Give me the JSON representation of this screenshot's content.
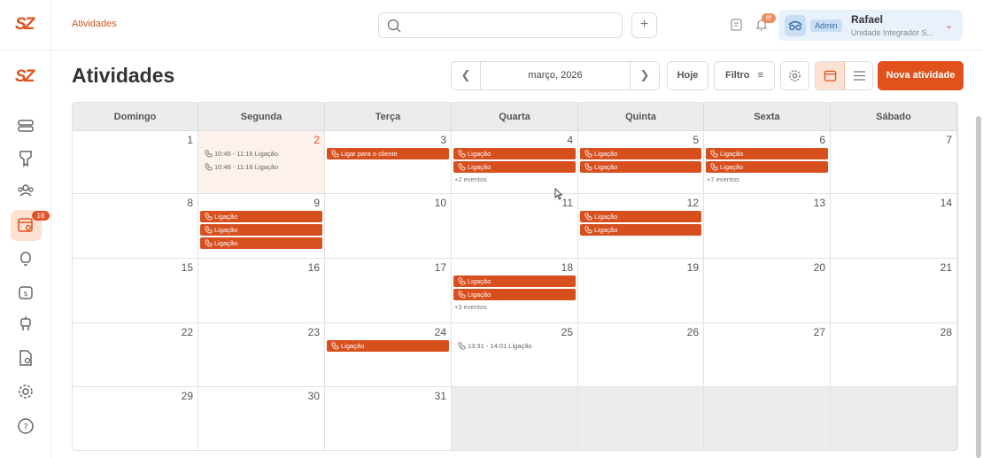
{
  "header": {
    "logo": "SZ",
    "breadcrumb": "Atividades",
    "search_placeholder": "",
    "plus_label": "+",
    "notification_count": "@",
    "user": {
      "role": "Admin",
      "name": "Rafael",
      "unit": "Unidade Integrador S..."
    }
  },
  "sidebar": {
    "logo": "SZ",
    "items": [
      {
        "icon": "layers-icon"
      },
      {
        "icon": "pin-icon"
      },
      {
        "icon": "users-icon"
      },
      {
        "icon": "calendar-search-icon",
        "badge": "16",
        "active": true
      },
      {
        "icon": "lightbulb-icon"
      },
      {
        "icon": "money-bag-icon"
      },
      {
        "icon": "robot-icon"
      },
      {
        "icon": "document-settings-icon"
      },
      {
        "icon": "gear-icon"
      },
      {
        "icon": "help-icon"
      }
    ]
  },
  "page": {
    "title": "Atividades",
    "month": "março, 2026",
    "today_label": "Hoje",
    "filter_label": "Filtro",
    "new_label": "Nova atividade"
  },
  "calendar": {
    "weekdays": [
      "Domingo",
      "Segunda",
      "Terça",
      "Quarta",
      "Quinta",
      "Sexta",
      "Sábado"
    ],
    "weeks": [
      [
        {
          "d": "1",
          "ev": []
        },
        {
          "d": "2",
          "today": true,
          "ev": [
            {
              "t": "10:46 - 11:16 Ligação",
              "plain": true
            },
            {
              "t": "10:46 - 11:16 Ligação",
              "plain": true
            }
          ]
        },
        {
          "d": "3",
          "ev": [
            {
              "t": "Ligar para o cliente"
            }
          ]
        },
        {
          "d": "4",
          "ev": [
            {
              "t": "Ligação"
            },
            {
              "t": "Ligação"
            }
          ],
          "more": "+2 eventos"
        },
        {
          "d": "5",
          "ev": [
            {
              "t": "Ligação"
            },
            {
              "t": "Ligação"
            }
          ]
        },
        {
          "d": "6",
          "ev": [
            {
              "t": "Ligação"
            },
            {
              "t": "Ligação"
            }
          ],
          "more": "+7 eventos"
        },
        {
          "d": "7",
          "ev": []
        }
      ],
      [
        {
          "d": "8",
          "ev": []
        },
        {
          "d": "9",
          "ev": [
            {
              "t": "Ligação"
            },
            {
              "t": "Ligação"
            },
            {
              "t": "Ligação"
            }
          ]
        },
        {
          "d": "10",
          "ev": []
        },
        {
          "d": "11",
          "ev": []
        },
        {
          "d": "12",
          "ev": [
            {
              "t": "Ligação"
            },
            {
              "t": "Ligação"
            }
          ]
        },
        {
          "d": "13",
          "ev": []
        },
        {
          "d": "14",
          "ev": []
        }
      ],
      [
        {
          "d": "15",
          "ev": []
        },
        {
          "d": "16",
          "ev": []
        },
        {
          "d": "17",
          "ev": []
        },
        {
          "d": "18",
          "ev": [
            {
              "t": "Ligação"
            },
            {
              "t": "Ligação"
            }
          ],
          "more": "+3 eventos"
        },
        {
          "d": "19",
          "ev": []
        },
        {
          "d": "20",
          "ev": []
        },
        {
          "d": "21",
          "ev": []
        }
      ],
      [
        {
          "d": "22",
          "ev": []
        },
        {
          "d": "23",
          "ev": []
        },
        {
          "d": "24",
          "ev": [
            {
              "t": "Ligação"
            }
          ]
        },
        {
          "d": "25",
          "ev": [
            {
              "t": "13:31 - 14:01 Ligação",
              "plain": true
            }
          ]
        },
        {
          "d": "26",
          "ev": []
        },
        {
          "d": "27",
          "ev": []
        },
        {
          "d": "28",
          "ev": []
        }
      ],
      [
        {
          "d": "29",
          "ev": []
        },
        {
          "d": "30",
          "ev": []
        },
        {
          "d": "31",
          "ev": []
        },
        {
          "d": "",
          "other": true,
          "ev": []
        },
        {
          "d": "",
          "other": true,
          "ev": []
        },
        {
          "d": "",
          "other": true,
          "ev": []
        },
        {
          "d": "",
          "other": true,
          "ev": []
        }
      ]
    ]
  },
  "colors": {
    "accent": "#e0511c",
    "event": "#d84f1e",
    "today_bg": "#fdf1ec"
  }
}
